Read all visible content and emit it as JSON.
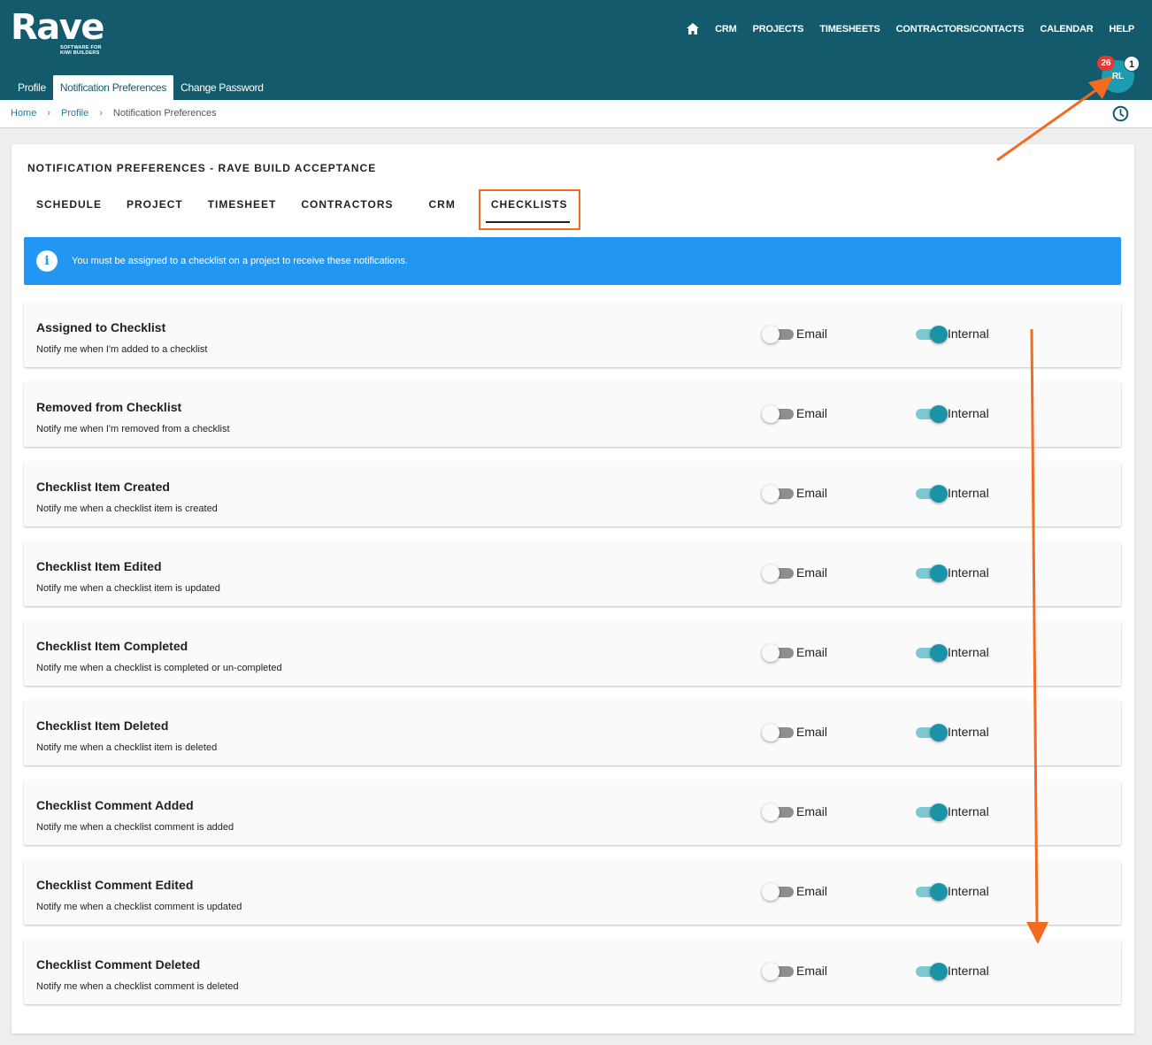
{
  "brand": {
    "name": "Rave",
    "tagline": "SOFTWARE FOR KIWI BUILDERS"
  },
  "topnav": {
    "items": [
      "CRM",
      "PROJECTS",
      "TIMESHEETS",
      "CONTRACTORS/CONTACTS",
      "CALENDAR",
      "HELP"
    ]
  },
  "subtabs": {
    "items": [
      "Profile",
      "Notification Preferences",
      "Change Password"
    ],
    "active": "Notification Preferences"
  },
  "user": {
    "initials": "RL",
    "notification_count": "26",
    "secondary_badge": "1"
  },
  "breadcrumb": {
    "home": "Home",
    "profile": "Profile",
    "current": "Notification Preferences"
  },
  "card": {
    "title": "NOTIFICATION PREFERENCES - RAVE BUILD ACCEPTANCE",
    "tabs": [
      "SCHEDULE",
      "PROJECT",
      "TIMESHEET",
      "CONTRACTORS",
      "CRM",
      "CHECKLISTS"
    ],
    "active_tab": "CHECKLISTS",
    "info_message": "You must be assigned to a checklist on a project to receive these notifications."
  },
  "labels": {
    "email": "Email",
    "internal": "Internal"
  },
  "preferences": [
    {
      "title": "Assigned to Checklist",
      "description": "Notify me when I'm added to a checklist",
      "email": false,
      "internal": true
    },
    {
      "title": "Removed from Checklist",
      "description": "Notify me when I'm removed from a checklist",
      "email": false,
      "internal": true
    },
    {
      "title": "Checklist Item Created",
      "description": "Notify me when a checklist item is created",
      "email": false,
      "internal": true
    },
    {
      "title": "Checklist Item Edited",
      "description": "Notify me when a checklist item is updated",
      "email": false,
      "internal": true
    },
    {
      "title": "Checklist Item Completed",
      "description": "Notify me when a checklist is completed or un-completed",
      "email": false,
      "internal": true
    },
    {
      "title": "Checklist Item Deleted",
      "description": "Notify me when a checklist item is deleted",
      "email": false,
      "internal": true
    },
    {
      "title": "Checklist Comment Added",
      "description": "Notify me when a checklist comment is added",
      "email": false,
      "internal": true
    },
    {
      "title": "Checklist Comment Edited",
      "description": "Notify me when a checklist comment is updated",
      "email": false,
      "internal": true
    },
    {
      "title": "Checklist Comment Deleted",
      "description": "Notify me when a checklist comment is deleted",
      "email": false,
      "internal": true
    }
  ],
  "colors": {
    "header": "#135b6c",
    "accent": "#1a93a8",
    "info": "#2196f3",
    "annotation": "#f26b21"
  }
}
